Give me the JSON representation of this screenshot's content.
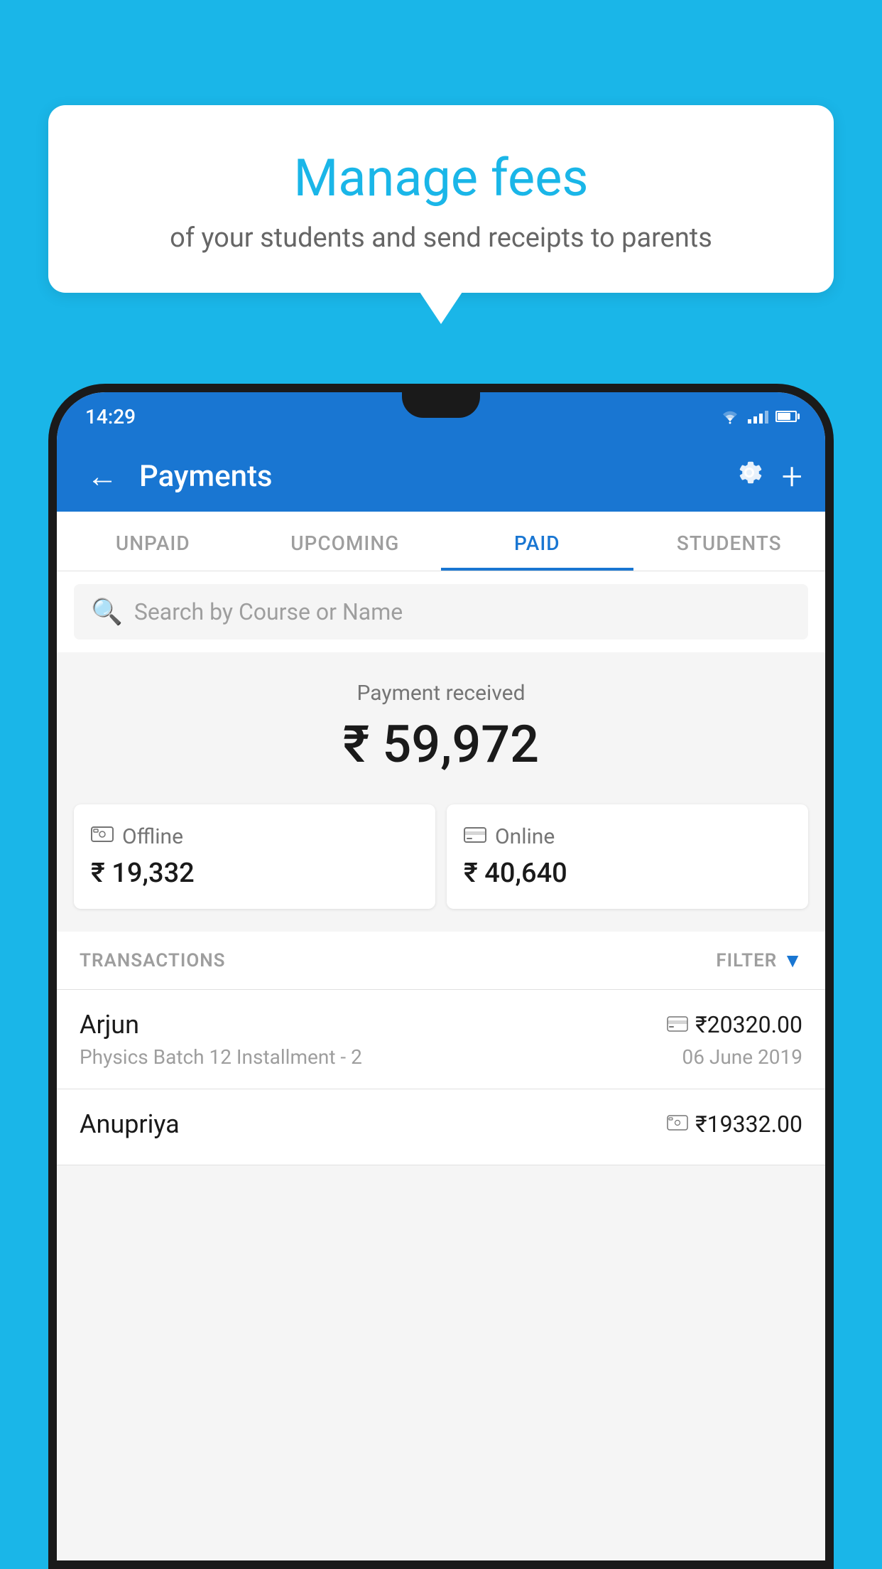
{
  "background_color": "#1ab6e8",
  "bubble": {
    "title": "Manage fees",
    "subtitle": "of your students and send receipts to parents"
  },
  "status_bar": {
    "time": "14:29",
    "wifi_icon": "wifi-icon",
    "signal_icon": "signal-icon",
    "battery_icon": "battery-icon"
  },
  "app_bar": {
    "title": "Payments",
    "back_icon": "back-arrow-icon",
    "settings_icon": "settings-icon",
    "add_icon": "add-icon"
  },
  "tabs": [
    {
      "label": "UNPAID",
      "active": false
    },
    {
      "label": "UPCOMING",
      "active": false
    },
    {
      "label": "PAID",
      "active": true
    },
    {
      "label": "STUDENTS",
      "active": false
    }
  ],
  "search": {
    "placeholder": "Search by Course or Name"
  },
  "payment_summary": {
    "label": "Payment received",
    "amount": "₹ 59,972",
    "offline_icon": "offline-payment-icon",
    "offline_label": "Offline",
    "offline_amount": "₹ 19,332",
    "online_icon": "online-payment-icon",
    "online_label": "Online",
    "online_amount": "₹ 40,640"
  },
  "transactions": {
    "header_label": "TRANSACTIONS",
    "filter_label": "FILTER",
    "rows": [
      {
        "name": "Arjun",
        "payment_icon": "card-payment-icon",
        "amount": "₹20320.00",
        "course": "Physics Batch 12 Installment - 2",
        "date": "06 June 2019"
      },
      {
        "name": "Anupriya",
        "payment_icon": "cash-payment-icon",
        "amount": "₹19332.00",
        "course": "",
        "date": ""
      }
    ]
  }
}
